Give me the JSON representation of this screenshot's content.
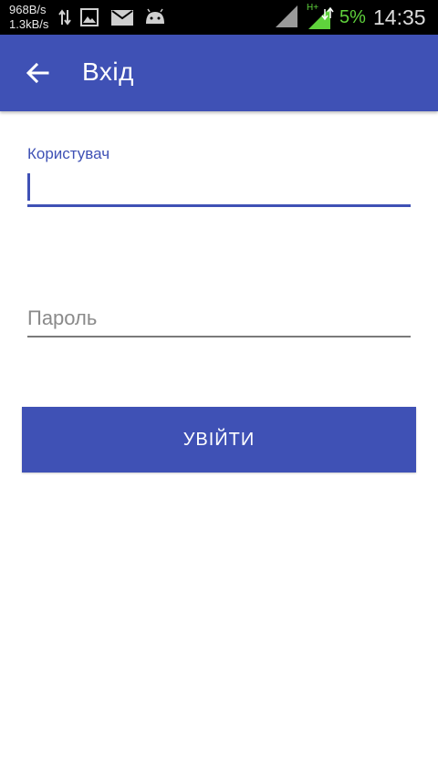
{
  "status_bar": {
    "download_speed": "968B/s",
    "upload_speed": "1.3kB/s",
    "battery_percent": "5%",
    "time": "14:35",
    "network_type": "H+",
    "icons": [
      "data-transfer-icon",
      "image-icon",
      "mail-icon",
      "android-icon",
      "signal-icon",
      "mobile-data-signal-icon"
    ]
  },
  "app_bar": {
    "title": "Вхід",
    "back_icon": "arrow-back-icon",
    "color": "#3f51b5"
  },
  "form": {
    "username": {
      "label": "Користувач",
      "value": ""
    },
    "password": {
      "placeholder": "Пароль",
      "value": ""
    },
    "login_button_label": "УВІЙТИ"
  },
  "colors": {
    "primary": "#3f51b5",
    "battery_low": "#5fd23c"
  }
}
